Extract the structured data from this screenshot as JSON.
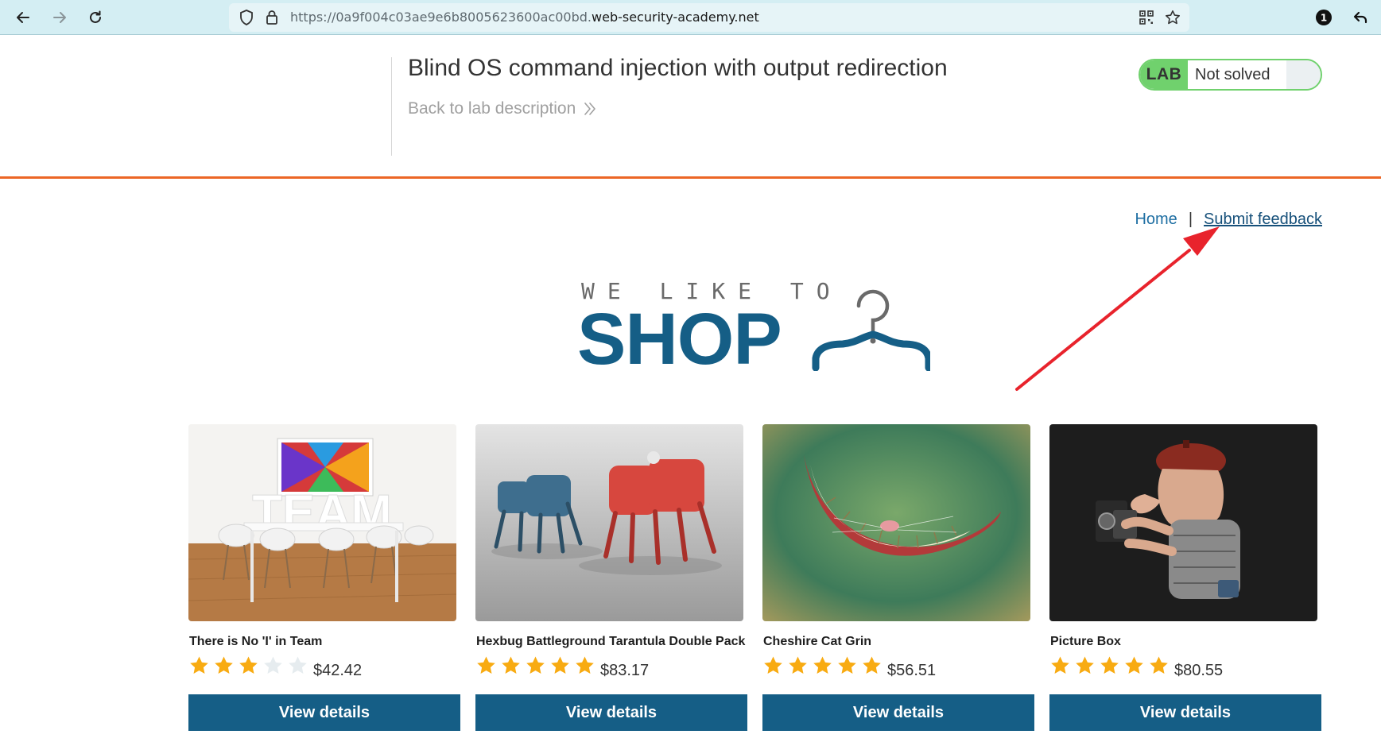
{
  "browser": {
    "url_prefix": "https://0a9f004c03ae9e6b8005623600ac00bd.",
    "url_domain": "web-security-academy.net",
    "notification_count": "1"
  },
  "lab": {
    "title": "Blind OS command injection with output redirection",
    "back_link": "Back to lab description",
    "badge": "LAB",
    "status": "Not solved"
  },
  "nav": {
    "home": "Home",
    "separator": "|",
    "feedback": "Submit feedback"
  },
  "logo": {
    "top_text": "WE LIKE TO",
    "main_text": "SHOP"
  },
  "colors": {
    "brand_blue": "#155e86",
    "accent_orange": "#ec6625",
    "lab_green": "#70d16d",
    "star_yellow": "#f8ab12",
    "annotation_red": "#e8232c"
  },
  "products": [
    {
      "name": "There is No 'I' in Team",
      "rating": 3,
      "price": "$42.42",
      "button": "View details",
      "image": "team-room-photo"
    },
    {
      "name": "Hexbug Battleground Tarantula Double Pack",
      "rating": 5,
      "price": "$83.17",
      "button": "View details",
      "image": "robot-spiders-photo"
    },
    {
      "name": "Cheshire Cat Grin",
      "rating": 5,
      "price": "$56.51",
      "button": "View details",
      "image": "cat-grin-photo"
    },
    {
      "name": "Picture Box",
      "rating": 5,
      "price": "$80.55",
      "button": "View details",
      "image": "photographer-figurine-photo"
    }
  ]
}
